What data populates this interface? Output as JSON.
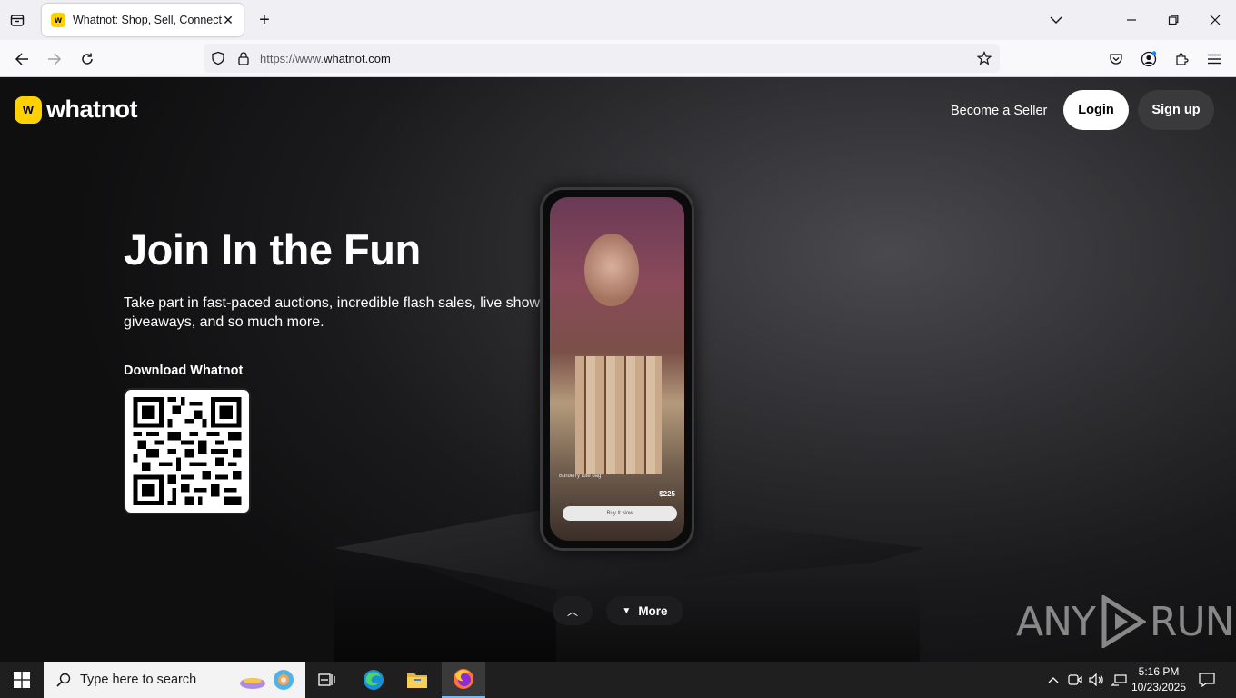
{
  "browser": {
    "tab_title": "Whatnot: Shop, Sell, Connect",
    "favicon_letter": "w",
    "url_prefix": "https://www.",
    "url_domain": "whatnot.com"
  },
  "header": {
    "logo_mark": "w",
    "logo_text": "whatnot",
    "become_seller": "Become a Seller",
    "login": "Login",
    "signup": "Sign up"
  },
  "hero": {
    "title": "Join In the Fun",
    "subtitle": "Take part in fast-paced auctions, incredible flash sales, live show giveaways, and so much more.",
    "download_label": "Download Whatnot"
  },
  "phone_screen": {
    "caption": "Burberry tote bag",
    "price": "$225",
    "buy_now": "Buy It Now"
  },
  "scroll_controls": {
    "more": "More"
  },
  "watermark": {
    "left": "ANY",
    "right": "RUN"
  },
  "taskbar": {
    "search_placeholder": "Type here to search",
    "time": "5:16 PM",
    "date": "10/23/2025"
  },
  "colors": {
    "brand_yellow": "#ffd100",
    "page_bg": "#1a1a1c",
    "taskbar": "#1f1f1f"
  }
}
